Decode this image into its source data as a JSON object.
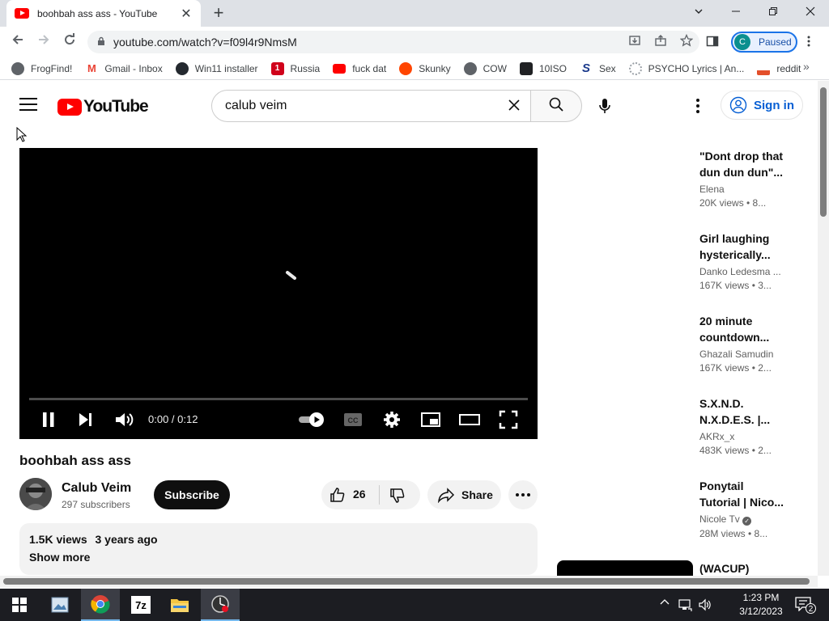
{
  "browser": {
    "tab_title": "boohbah ass ass - YouTube",
    "url": "youtube.com/watch?v=f09l4r9NmsM",
    "profile_initial": "C",
    "profile_status": "Paused",
    "bookmarks": [
      {
        "label": "FrogFind!",
        "icon": "globe-icon"
      },
      {
        "label": "Gmail - Inbox",
        "icon": "gmail-icon"
      },
      {
        "label": "Win11 installer",
        "icon": "github-icon"
      },
      {
        "label": "Russia",
        "icon": "russia-icon"
      },
      {
        "label": "fuck dat",
        "icon": "youtube-icon"
      },
      {
        "label": "Skunky",
        "icon": "reddit-icon"
      },
      {
        "label": "COW",
        "icon": "globe-icon"
      },
      {
        "label": "10ISO",
        "icon": "building-icon"
      },
      {
        "label": "Sex",
        "icon": "s-icon"
      },
      {
        "label": "PSYCHO Lyrics | An...",
        "icon": "loading-icon"
      },
      {
        "label": "reddit",
        "icon": "ufo-icon"
      }
    ]
  },
  "youtube": {
    "logo_text": "YouTube",
    "search_query": "calub veim",
    "signin_label": "Sign in"
  },
  "player": {
    "time": "0:00 / 0:12",
    "progress": 0
  },
  "video": {
    "title": "boohbah ass ass",
    "channel": "Calub Veim",
    "subscribers": "297 subscribers",
    "subscribe_label": "Subscribe",
    "likes": "26",
    "share_label": "Share",
    "views": "1.5K views",
    "age": "3 years ago",
    "show_more": "Show more"
  },
  "recommendations": [
    {
      "title_l1": "\"Dont drop that",
      "title_l2": "dun dun dun\"...",
      "channel": "Elena",
      "meta": "20K views  • 8..."
    },
    {
      "title_l1": "Girl laughing",
      "title_l2": "hysterically...",
      "channel": "Danko Ledesma ...",
      "meta": "167K views  • 3..."
    },
    {
      "title_l1": "20 minute",
      "title_l2": "countdown...",
      "channel": "Ghazali Samudin",
      "meta": "167K views  • 2..."
    },
    {
      "title_l1": "S.X.N.D.",
      "title_l2": "N.X.D.E.S. |...",
      "channel": "AKRx_x",
      "meta": "483K views  • 2..."
    },
    {
      "title_l1": "Ponytail",
      "title_l2": "Tutorial | Nico...",
      "channel": "Nicole Tv",
      "meta": "28M views  • 8..."
    },
    {
      "title_l1": "(WACUP)",
      "title_l2": "",
      "channel": "",
      "meta": ""
    }
  ],
  "taskbar": {
    "time": "1:23 PM",
    "date": "3/12/2023",
    "notifications": "2"
  },
  "colors": {
    "youtube_red": "#ff0000",
    "link_blue": "#065fd4",
    "chrome_blue": "#1a73e8"
  }
}
